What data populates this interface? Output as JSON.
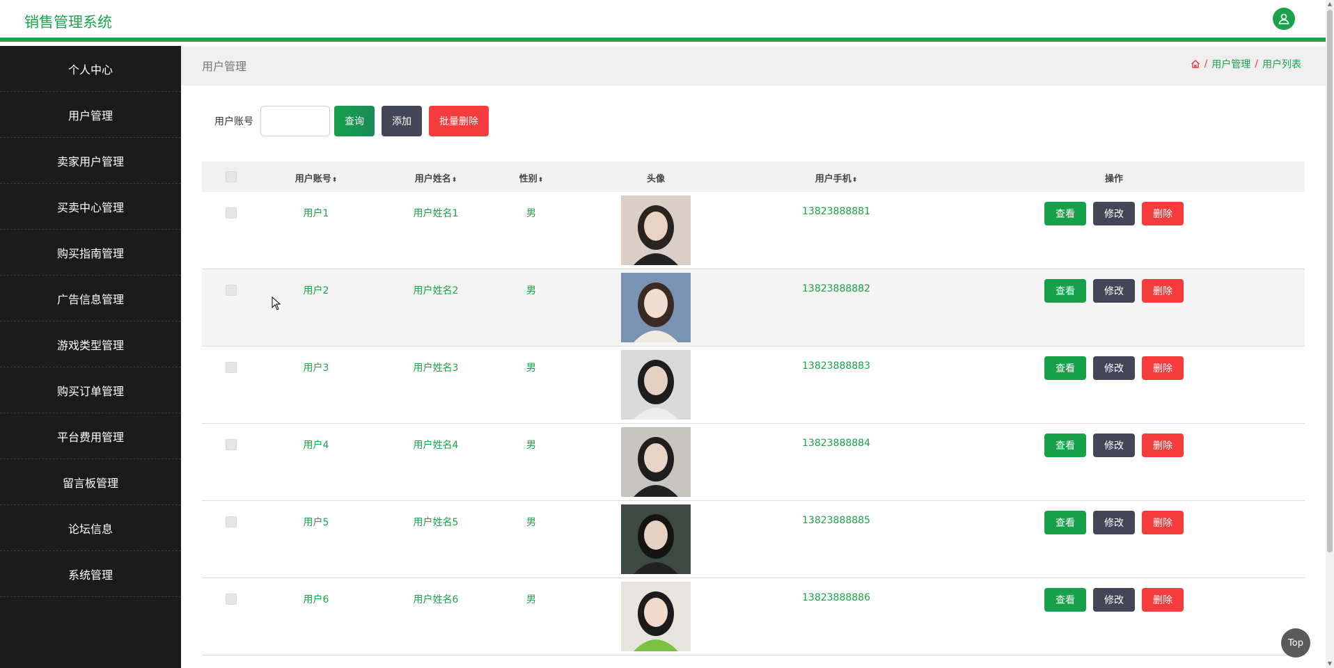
{
  "header": {
    "title": "销售管理系统"
  },
  "sidebar": {
    "items": [
      {
        "label": "个人中心"
      },
      {
        "label": "用户管理"
      },
      {
        "label": "卖家用户管理"
      },
      {
        "label": "买卖中心管理"
      },
      {
        "label": "购买指南管理"
      },
      {
        "label": "广告信息管理"
      },
      {
        "label": "游戏类型管理"
      },
      {
        "label": "购买订单管理"
      },
      {
        "label": "平台费用管理"
      },
      {
        "label": "留言板管理"
      },
      {
        "label": "论坛信息"
      },
      {
        "label": "系统管理"
      }
    ]
  },
  "page": {
    "title": "用户管理",
    "breadcrumb": [
      "用户管理",
      "用户列表"
    ],
    "separator": "/"
  },
  "search": {
    "label": "用户账号",
    "value": "",
    "query_label": "查询",
    "add_label": "添加",
    "batch_delete_label": "批量删除"
  },
  "table": {
    "columns": {
      "account": "用户账号",
      "name": "用户姓名",
      "gender": "性别",
      "avatar": "头像",
      "phone": "用户手机",
      "actions": "操作"
    },
    "sort_glyph": "⬍",
    "actions": {
      "view": "查看",
      "edit": "修改",
      "delete": "删除"
    },
    "rows": [
      {
        "account": "用户1",
        "name": "用户姓名1",
        "gender": "男",
        "phone": "13823888881"
      },
      {
        "account": "用户2",
        "name": "用户姓名2",
        "gender": "男",
        "phone": "13823888882"
      },
      {
        "account": "用户3",
        "name": "用户姓名3",
        "gender": "男",
        "phone": "13823888883"
      },
      {
        "account": "用户4",
        "name": "用户姓名4",
        "gender": "男",
        "phone": "13823888884"
      },
      {
        "account": "用户5",
        "name": "用户姓名5",
        "gender": "男",
        "phone": "13823888885"
      },
      {
        "account": "用户6",
        "name": "用户姓名6",
        "gender": "男",
        "phone": "13823888886"
      }
    ]
  },
  "top_button": {
    "label": "Top"
  },
  "colors": {
    "accent": "#1aa34a",
    "danger": "#f53c3c",
    "dark": "#434656",
    "sidebar": "#1b1b1b"
  },
  "icons": {
    "user": "user-icon",
    "home": "home-icon"
  }
}
